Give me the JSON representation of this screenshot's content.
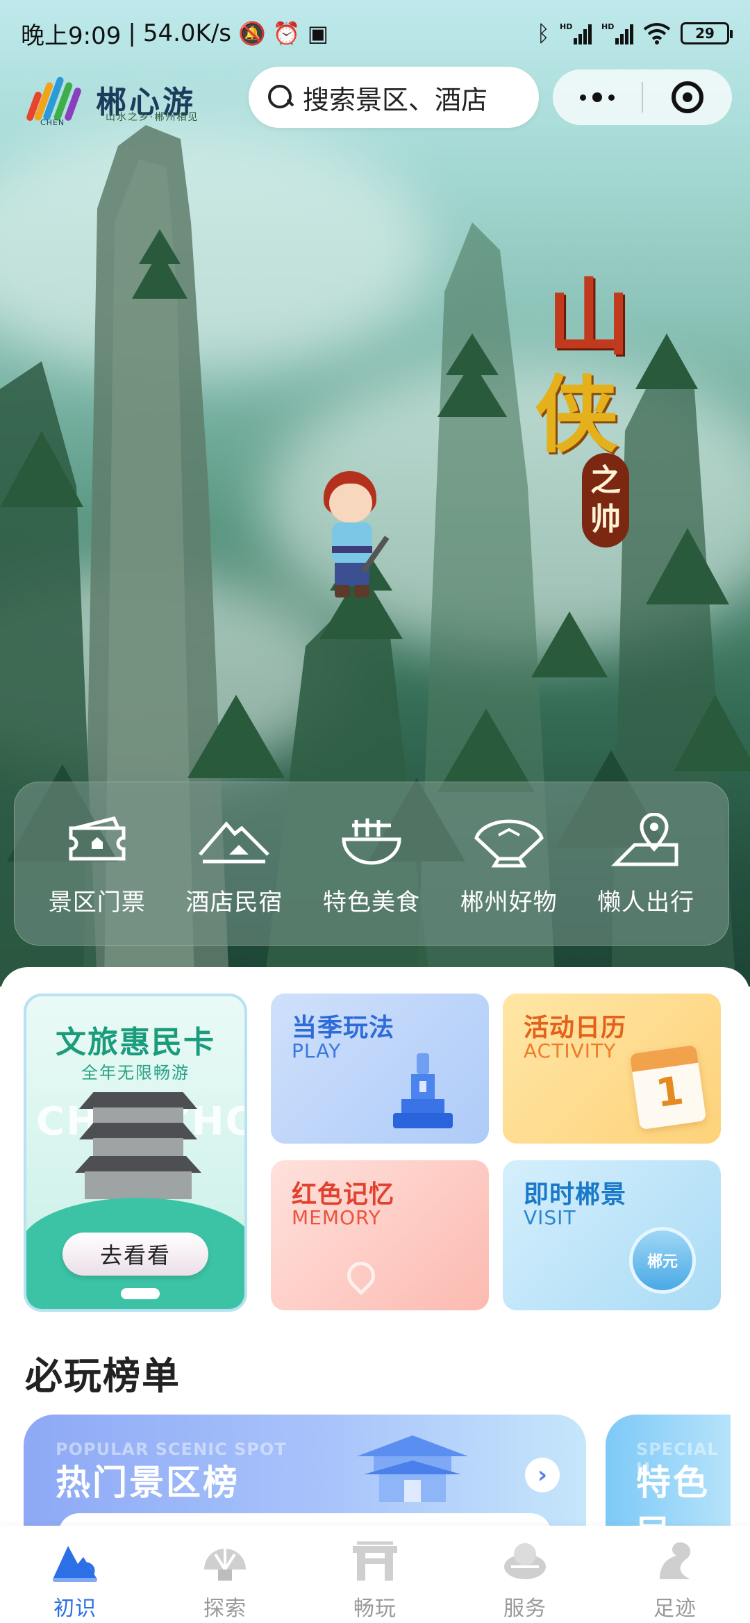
{
  "status_bar": {
    "time": "晚上9:09",
    "separator": "|",
    "net_speed": "54.0K/s",
    "battery": "29",
    "icons": [
      "mute-icon",
      "alarm-icon",
      "nfc-icon",
      "bluetooth-icon",
      "signal-hd-icon",
      "signal-hd-icon",
      "wifi-icon",
      "battery-icon"
    ]
  },
  "header": {
    "logo_text": "郴心游",
    "logo_sub": "山水之乡·郴州相见",
    "logo_mark_label": "CHEN",
    "search_placeholder": "搜索景区、酒店"
  },
  "hero": {
    "title_line1": "山",
    "title_line2": "侠",
    "seal_top": "之",
    "seal_bottom": "帅"
  },
  "quick_nav": [
    {
      "label": "景区门票",
      "icon": "ticket-icon"
    },
    {
      "label": "酒店民宿",
      "icon": "hotel-icon"
    },
    {
      "label": "特色美食",
      "icon": "noodle-bowl-icon"
    },
    {
      "label": "郴州好物",
      "icon": "fan-icon"
    },
    {
      "label": "懒人出行",
      "icon": "map-pin-icon"
    }
  ],
  "huimin_card": {
    "title": "文旅惠民卡",
    "subtitle": "全年无限畅游",
    "bg_word": "CHENZHOU",
    "button": "去看看"
  },
  "features": {
    "play": {
      "title": "当季玩法",
      "en": "PLAY"
    },
    "activity": {
      "title": "活动日历",
      "en": "ACTIVITY",
      "calendar_day": "1"
    },
    "memory": {
      "title": "红色记忆",
      "en": "MEMORY"
    },
    "visit": {
      "title": "即时郴景",
      "en": "VISIT",
      "coin_text": "郴元"
    }
  },
  "ranking": {
    "section_title": "必玩榜单",
    "main_en": "POPULAR SCENIC SPOT",
    "main_title": "热门景区榜",
    "side_en": "SPECIAL H",
    "side_title": "特色民"
  },
  "tabbar": [
    {
      "label": "初识",
      "icon": "mountain-logo-icon",
      "active": true
    },
    {
      "label": "探索",
      "icon": "compass-icon",
      "active": false
    },
    {
      "label": "畅玩",
      "icon": "gate-icon",
      "active": false
    },
    {
      "label": "服务",
      "icon": "service-icon",
      "active": false
    },
    {
      "label": "足迹",
      "icon": "dragon-icon",
      "active": false
    }
  ],
  "colors": {
    "accent_blue": "#2d6fe6",
    "huimin_green": "#1a9c7c",
    "tab_inactive": "#9a9a9a"
  }
}
